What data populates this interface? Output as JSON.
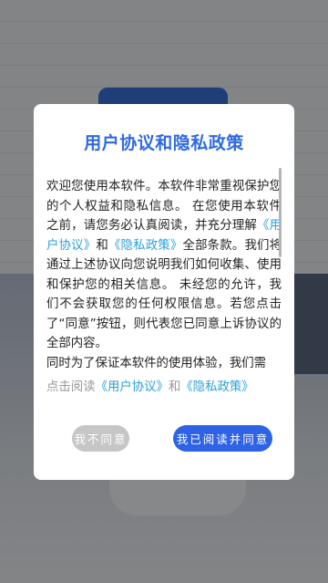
{
  "dialog": {
    "title": "用户协议和隐私政策",
    "body": {
      "p1": "欢迎您使用本软件。本软件非常重视保护您的个人权益和隐私信息。 在您使用本软件之前，请您务必认真阅读，并充分理解",
      "link_user_agreement": "《用户协议》",
      "and": "和",
      "link_privacy_policy": "《隐私政策》",
      "p2": "全部条款。我们将通过上述协议向您说明我们如何收集、使用和保护您的相关信息。 未经您的允许，我们不会获取您的任何权限信息。若您点击了“同意”按钮，则代表您已同意上诉协议的全部内容。",
      "p3": " 同时为了保证本软件的使用体验，我们需"
    },
    "footer": {
      "prefix": "点击阅读",
      "link_user_agreement": "《用户协议》",
      "and": "和",
      "link_privacy_policy": "《隐私政策》"
    },
    "buttons": {
      "disagree": "我不同意",
      "agree": "我已阅读并同意"
    }
  },
  "colors": {
    "title": "#2f6ae0",
    "link": "#2aa0d8",
    "agree_button": "#2e63e6",
    "disagree_button": "#c6c6c6"
  }
}
